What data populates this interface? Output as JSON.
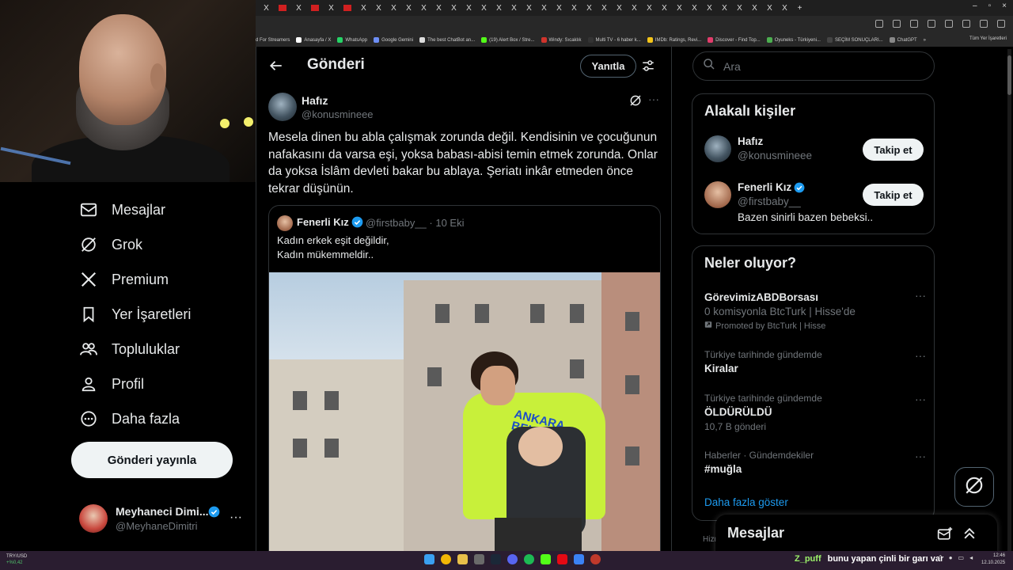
{
  "browser": {
    "tab_close_glyph": "X",
    "new_tab_glyph": "+",
    "bookmarks": [
      "d For Streamers",
      "Anasayfa / X",
      "WhatsApp",
      "Google Gemini",
      "The best ChatBot an...",
      "(19) Alert Box / Stre...",
      "Windy: Sıcaklık",
      "Multi TV - 6 haber k...",
      "IMDb: Ratings, Revi...",
      "Discover - Find Top...",
      "Oyuneks - Türkiyeni...",
      "SEÇİM SONUÇLARI...",
      "ChatGPT"
    ],
    "bookmarks_more": "»",
    "all_bookmarks": "Tüm Yer İşaretleri"
  },
  "leftnav": {
    "items": [
      {
        "label": "Mesajlar",
        "icon": "envelope-icon"
      },
      {
        "label": "Grok",
        "icon": "grok-icon"
      },
      {
        "label": "Premium",
        "icon": "x-logo-icon"
      },
      {
        "label": "Yer İşaretleri",
        "icon": "bookmark-icon"
      },
      {
        "label": "Topluluklar",
        "icon": "people-icon"
      },
      {
        "label": "Profil",
        "icon": "person-icon"
      },
      {
        "label": "Daha fazla",
        "icon": "more-circle-icon"
      }
    ],
    "post_button": "Gönderi yayınla",
    "profile": {
      "name": "Meyhaneci Dimi...",
      "handle": "@MeyhaneDimitri",
      "more": "···"
    }
  },
  "main": {
    "header": {
      "title": "Gönderi",
      "reply_button": "Yanıtla"
    },
    "tweet": {
      "name": "Hafız",
      "handle": "@konusmineee",
      "more": "···",
      "text": "Mesela dinen bu abla çalışmak zorunda değil. Kendisinin ve çocuğunun nafakasını da varsa eşi, yoksa babası-abisi temin etmek zorunda. Onlar da yoksa İslâm devleti bakar bu ablaya. Şeriatı inkâr etmeden önce tekrar düşünün."
    },
    "quote": {
      "name": "Fenerli Kız",
      "handle": "@firstbaby__",
      "date": "· 10 Eki",
      "line1": "Kadın erkek eşit değildir,",
      "line2": "Kadın mükemmeldir..",
      "image_vest_text_1": "ANKARA",
      "image_vest_text_2": "BELEDİYESİ"
    }
  },
  "right": {
    "search_placeholder": "Ara",
    "related": {
      "title": "Alakalı kişiler",
      "people": [
        {
          "name": "Hafız",
          "handle": "@konusmineee",
          "bio": "",
          "follow": "Takip et"
        },
        {
          "name": "Fenerli Kız",
          "handle": "@firstbaby__",
          "bio": "Bazen sinirli bazen bebeksi..",
          "follow": "Takip et"
        }
      ]
    },
    "trends": {
      "title": "Neler oluyor?",
      "items": [
        {
          "context": "",
          "name": "GörevimizABDBorsası",
          "sub": "0 komisyonla BtcTurk | Hisse'de",
          "meta": "Promoted by BtcTurk | Hisse"
        },
        {
          "context": "Türkiye tarihinde gündemde",
          "name": "Kiralar",
          "sub": "",
          "meta": ""
        },
        {
          "context": "Türkiye tarihinde gündemde",
          "name": "ÖLDÜRÜLDÜ",
          "sub": "",
          "meta": "10,7 B gönderi"
        },
        {
          "context": "Haberler · Gündemdekiler",
          "name": "#muğla",
          "sub": "",
          "meta": ""
        }
      ],
      "more_dots": "···",
      "show_more": "Daha fazla göster"
    },
    "below_card_text": "Hizm"
  },
  "messages_drawer": {
    "title": "Mesajlar"
  },
  "taskbar": {
    "ticker": "TRY/USD",
    "ticker_change": "+%0,42",
    "chat_user": "Z_puff",
    "chat_message": "bunu yapan çinli bir garı var",
    "time": "12:46",
    "date": "12.10.2025"
  },
  "colors": {
    "accent": "#1d9bf0",
    "background": "#000000",
    "border": "#2f3336",
    "muted_text": "#71767b",
    "vest": "#c8f03a"
  }
}
